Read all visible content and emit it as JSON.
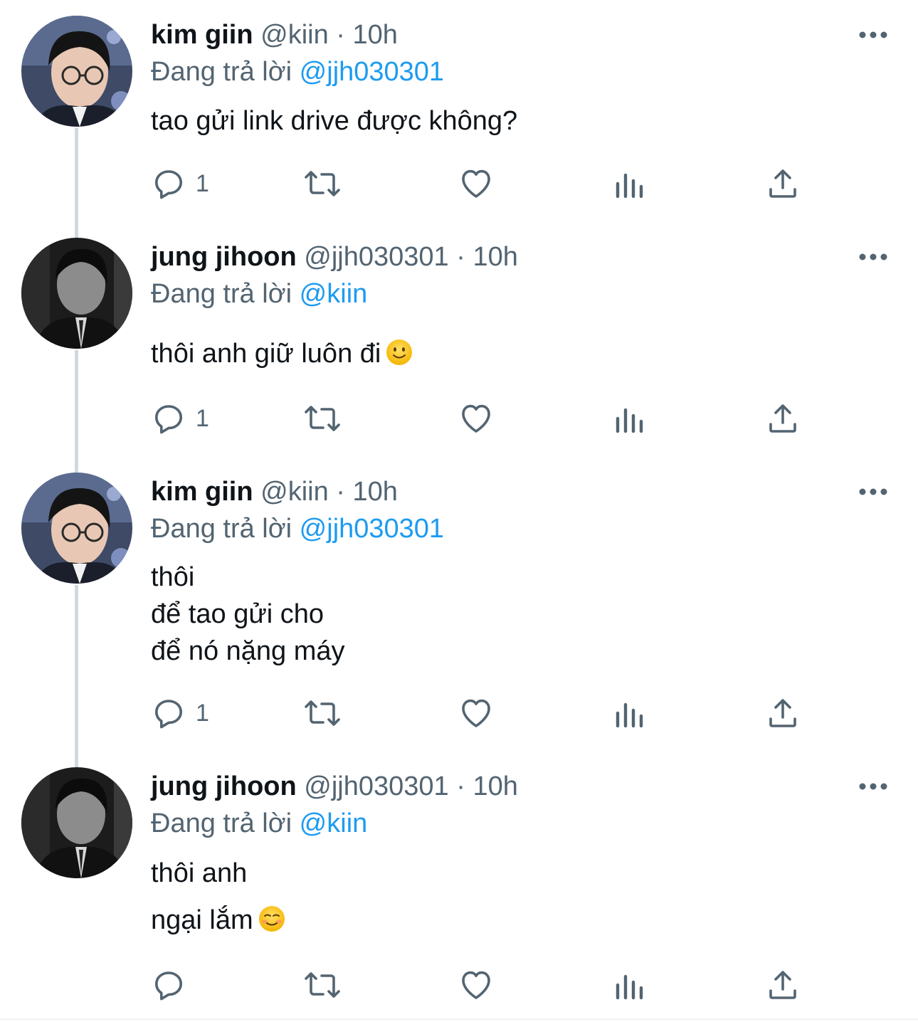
{
  "tweets": [
    {
      "display_name": "kim giin",
      "handle": "@kiin",
      "separator": "·",
      "time": "10h",
      "reply_prefix": "Đang trả lời",
      "reply_to": "@jjh030301",
      "lines": [
        "tao gửi link drive được không?"
      ],
      "reply_count": "1",
      "avatar": "kim-giin-photo"
    },
    {
      "display_name": "jung jihoon",
      "handle": "@jjh030301",
      "separator": "·",
      "time": "10h",
      "reply_prefix": "Đang trả lời",
      "reply_to": "@kiin",
      "lines": [
        "thôi anh giữ luôn đi"
      ],
      "emoji": [
        "slightly-smiling-face"
      ],
      "reply_count": "1",
      "avatar": "jung-jihoon-photo-bw"
    },
    {
      "display_name": "kim giin",
      "handle": "@kiin",
      "separator": "·",
      "time": "10h",
      "reply_prefix": "Đang trả lời",
      "reply_to": "@jjh030301",
      "lines": [
        "thôi",
        "để tao gửi cho",
        "để nó nặng máy"
      ],
      "reply_count": "1",
      "avatar": "kim-giin-photo"
    },
    {
      "display_name": "jung jihoon",
      "handle": "@jjh030301",
      "separator": "·",
      "time": "10h",
      "reply_prefix": "Đang trả lời",
      "reply_to": "@kiin",
      "lines": [
        "thôi anh",
        "ngại lắm"
      ],
      "emoji": [
        "smiling-face"
      ],
      "reply_count": "",
      "avatar": "jung-jihoon-photo-bw"
    }
  ],
  "actions": [
    "reply-icon",
    "retweet-icon",
    "like-icon",
    "analytics-icon",
    "share-icon"
  ],
  "colors": {
    "text": "#0f1419",
    "secondary": "#536471",
    "mention": "#1d9bf0",
    "thread_line": "#cfd9de"
  }
}
